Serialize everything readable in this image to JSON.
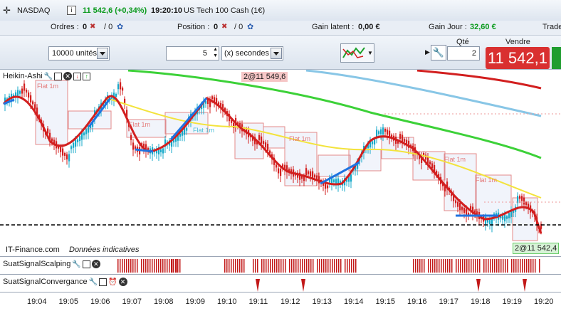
{
  "toolbar": {
    "instrument_code": "NASDAQ",
    "price_change": "11 542,6 (+0,34%)",
    "time": "19:20:10",
    "instrument_name": "US Tech 100 Cash (1€)"
  },
  "status": {
    "orders_label": "Ordres :",
    "orders_a": "0",
    "orders_b": "/ 0",
    "position_label": "Position :",
    "position_a": "0",
    "position_b": "/ 0",
    "gain_latent_label": "Gain latent :",
    "gain_latent_value": "0,00 €",
    "gain_jour_label": "Gain Jour :",
    "gain_jour_value": "32,60 €",
    "trade_label": "Trade"
  },
  "order": {
    "units": "10000 unités",
    "interval_value": "5",
    "interval_unit": "(x) secondes",
    "qty_label": "Qté",
    "qty_value": "2",
    "sell_label": "Vendre",
    "sell_price": "11 542,1"
  },
  "chart": {
    "indicator_name": "Heikin-Ashi",
    "top_marker": "2@11 549,6",
    "price_tag": "2@11 542,4",
    "source_label": "IT-Finance.com",
    "source_note": "Données indicatives",
    "flat_label": "Flat 1m"
  },
  "subpanels": {
    "scalping": "SuatSignalScalping",
    "convergance": "SuatSignalConvergance"
  },
  "time_axis": [
    "19:04",
    "19:05",
    "19:06",
    "19:07",
    "19:08",
    "19:09",
    "19:10",
    "19:11",
    "19:12",
    "19:13",
    "19:14",
    "19:15",
    "19:16",
    "19:17",
    "19:18",
    "19:19",
    "19:20"
  ],
  "colors": {
    "up": "#17a9c9",
    "down": "#d21f1f",
    "buy_text": "#0a9a1c",
    "sell_button": "#d93030"
  }
}
